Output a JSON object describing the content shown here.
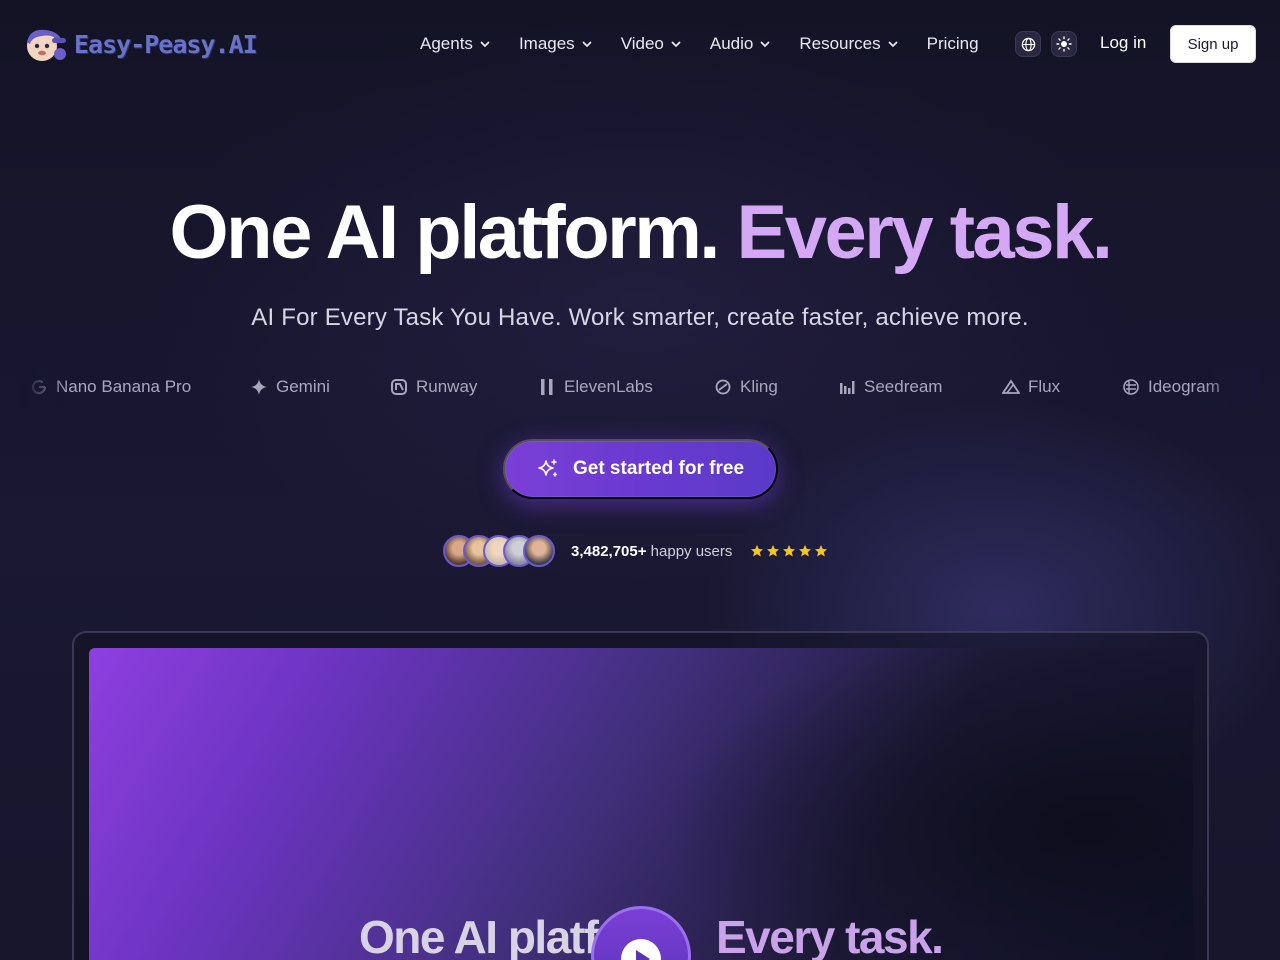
{
  "brand": {
    "name": "Easy-Peasy.AI"
  },
  "nav": {
    "items": [
      {
        "label": "Agents",
        "dropdown": true
      },
      {
        "label": "Images",
        "dropdown": true
      },
      {
        "label": "Video",
        "dropdown": true
      },
      {
        "label": "Audio",
        "dropdown": true
      },
      {
        "label": "Resources",
        "dropdown": true
      },
      {
        "label": "Pricing",
        "dropdown": false
      }
    ],
    "language_icon": "globe-icon",
    "theme_icon": "sun-icon",
    "login_label": "Log in",
    "signup_label": "Sign up"
  },
  "hero": {
    "title_main": "One AI platform.",
    "title_accent": "Every task.",
    "subtitle": "AI For Every Task You Have. Work smarter, create faster, achieve more."
  },
  "models": [
    {
      "label": "Nano Banana Pro",
      "icon": "google-icon"
    },
    {
      "label": "Gemini",
      "icon": "sparkle-icon"
    },
    {
      "label": "Runway",
      "icon": "runway-icon"
    },
    {
      "label": "ElevenLabs",
      "icon": "elevenlabs-icon"
    },
    {
      "label": "Kling",
      "icon": "kling-icon"
    },
    {
      "label": "Seedream",
      "icon": "bars-icon"
    },
    {
      "label": "Flux",
      "icon": "flux-icon"
    },
    {
      "label": "Ideogram",
      "icon": "ideogram-icon"
    }
  ],
  "cta": {
    "label": "Get started for free",
    "icon": "sparkles-icon"
  },
  "social_proof": {
    "count": "3,482,705+",
    "suffix": "happy users",
    "rating_stars": 5
  },
  "preview": {
    "title_main": "One AI platf",
    "title_accent": "Every task.",
    "play_icon": "play-icon"
  },
  "colors": {
    "accent_text": "#d4a8f4",
    "cta": "#6a3ad0",
    "star": "#f5c518",
    "background": "#16142a"
  }
}
